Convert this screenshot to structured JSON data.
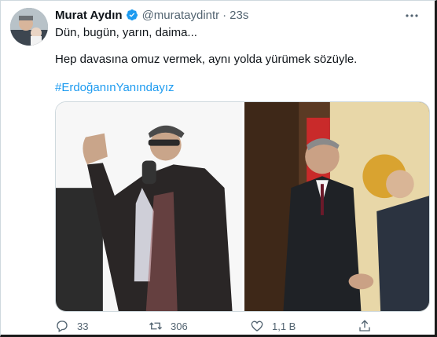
{
  "tweet": {
    "author_name": "Murat Aydın",
    "handle": "@murataydintr",
    "separator": "·",
    "time": "23s",
    "line1": "Dün, bugün, yarın, daima...",
    "line2": "Hep davasına omuz vermek, aynı yolda yürümek sözüyle.",
    "hashtag": "#ErdoğanınYanındayız"
  },
  "actions": {
    "replies": "33",
    "retweets": "306",
    "likes": "1,1 B"
  },
  "colors": {
    "accent": "#1d9bf0",
    "text": "#0f1419",
    "secondary": "#536471"
  },
  "icons": {
    "verified": "verified-badge-icon",
    "more": "more-icon",
    "reply": "reply-icon",
    "retweet": "retweet-icon",
    "like": "heart-icon",
    "share": "share-icon"
  }
}
